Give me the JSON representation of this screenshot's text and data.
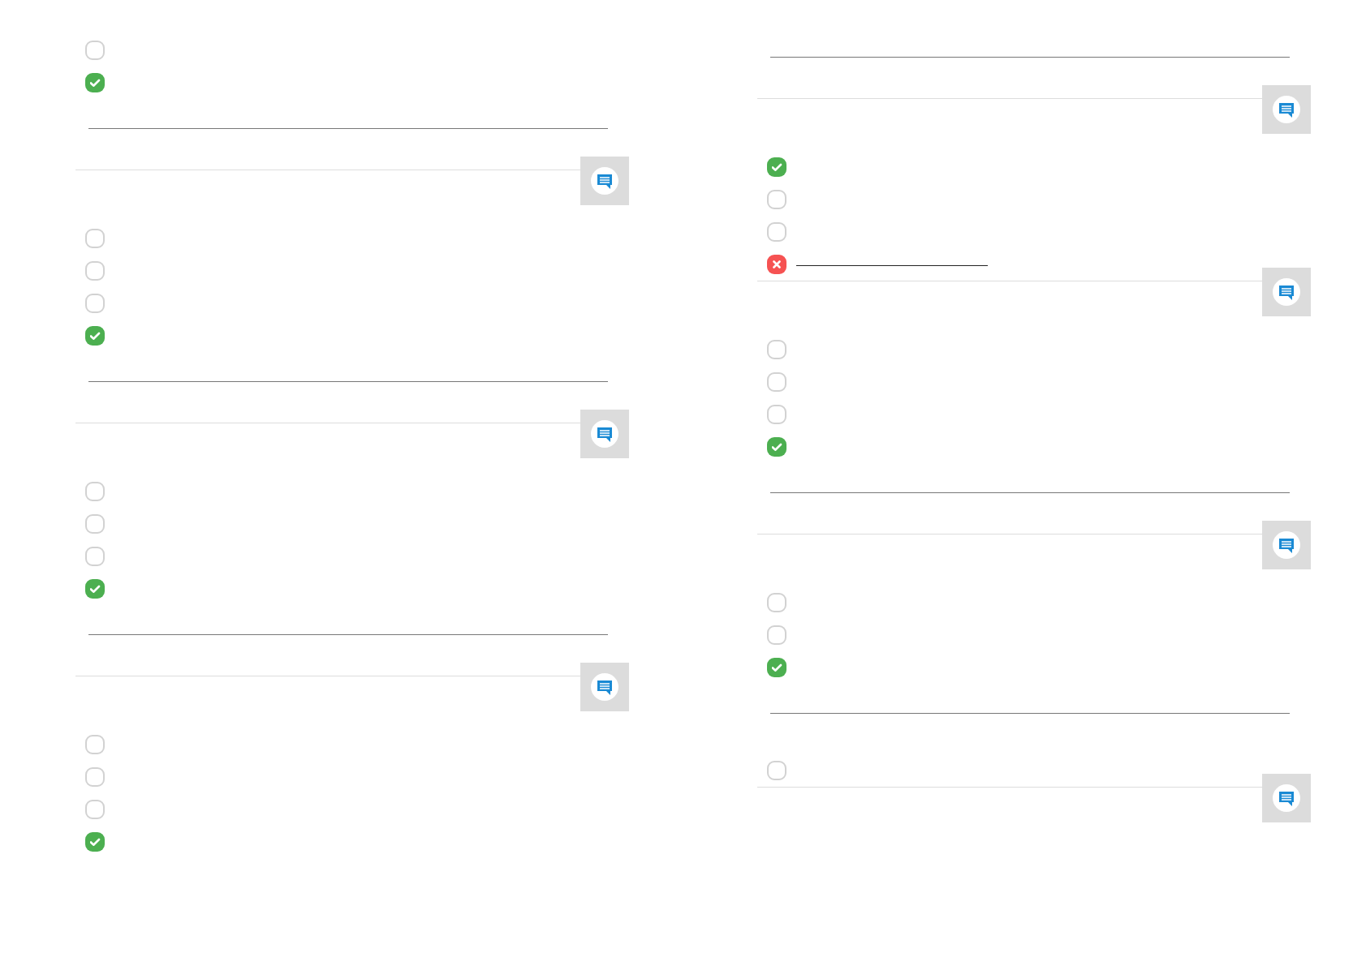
{
  "columns": [
    {
      "items": [
        {
          "kind": "option",
          "checked": false
        },
        {
          "kind": "option",
          "checked": true
        },
        {
          "kind": "rule"
        },
        {
          "kind": "question"
        },
        {
          "kind": "option",
          "checked": false
        },
        {
          "kind": "option",
          "checked": false
        },
        {
          "kind": "option",
          "checked": false
        },
        {
          "kind": "option",
          "checked": true
        },
        {
          "kind": "rule"
        },
        {
          "kind": "question"
        },
        {
          "kind": "option",
          "checked": false
        },
        {
          "kind": "option",
          "checked": false
        },
        {
          "kind": "option",
          "checked": false
        },
        {
          "kind": "option",
          "checked": true
        },
        {
          "kind": "rule"
        },
        {
          "kind": "question"
        },
        {
          "kind": "option",
          "checked": false
        },
        {
          "kind": "option",
          "checked": false
        },
        {
          "kind": "option",
          "checked": false
        },
        {
          "kind": "option",
          "checked": true
        }
      ]
    },
    {
      "items": [
        {
          "kind": "rule"
        },
        {
          "kind": "question"
        },
        {
          "kind": "option",
          "checked": true
        },
        {
          "kind": "option",
          "checked": false
        },
        {
          "kind": "option",
          "checked": false
        },
        {
          "kind": "option",
          "checked": true,
          "wrong": true,
          "blank": true
        },
        {
          "kind": "question"
        },
        {
          "kind": "option",
          "checked": false
        },
        {
          "kind": "option",
          "checked": false
        },
        {
          "kind": "option",
          "checked": false
        },
        {
          "kind": "option",
          "checked": true
        },
        {
          "kind": "rule"
        },
        {
          "kind": "question"
        },
        {
          "kind": "option",
          "checked": false
        },
        {
          "kind": "option",
          "checked": false
        },
        {
          "kind": "option",
          "checked": true
        },
        {
          "kind": "rule"
        },
        {
          "kind": "option",
          "checked": false
        },
        {
          "kind": "question"
        }
      ]
    }
  ]
}
